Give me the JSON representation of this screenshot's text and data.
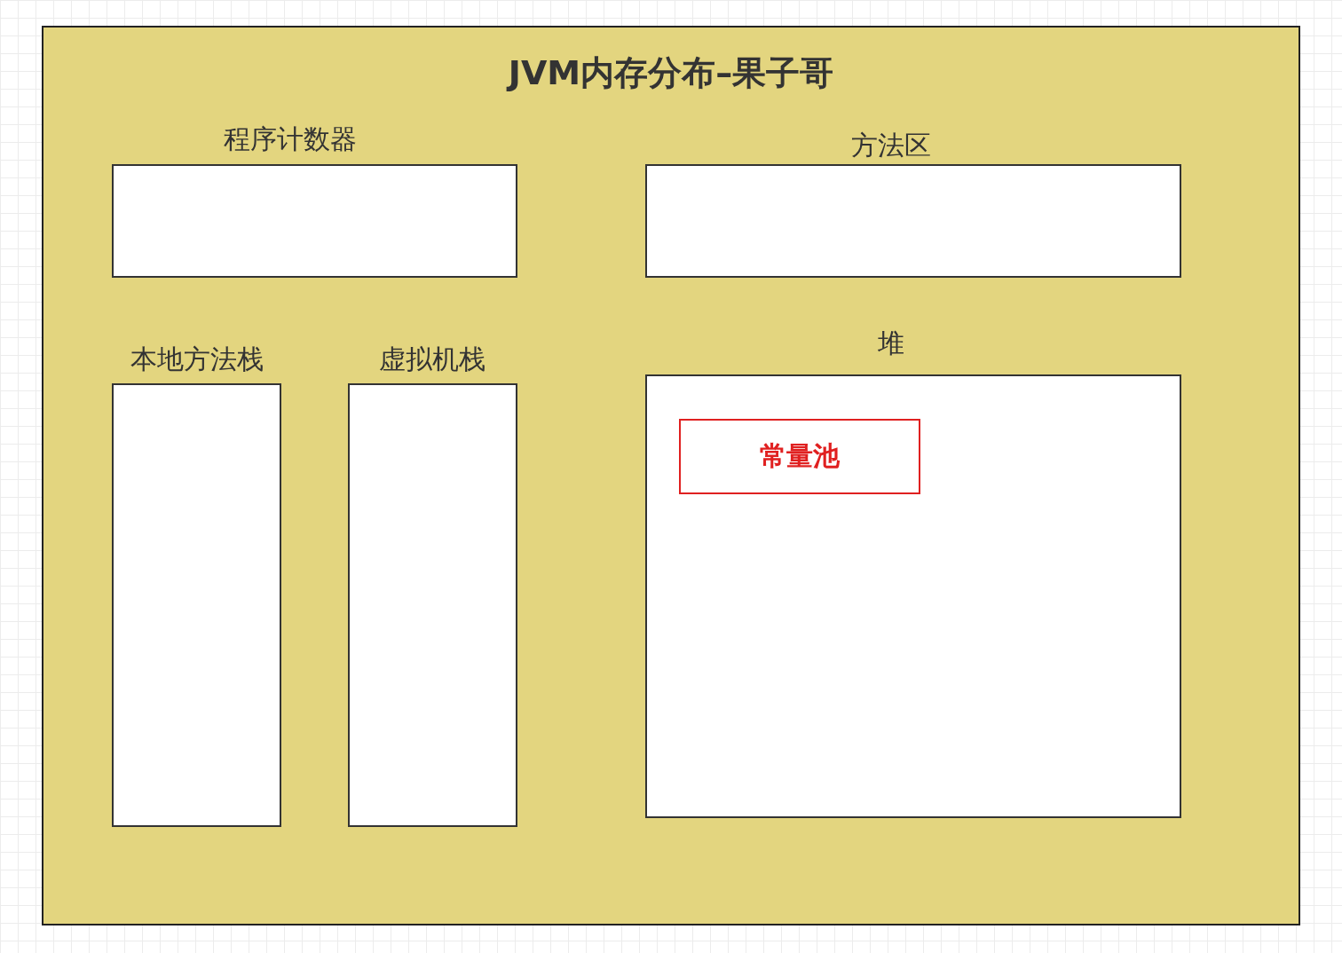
{
  "title": "JVM内存分布–果子哥",
  "regions": [
    {
      "label": "程序计数器"
    },
    {
      "label": "方法区"
    },
    {
      "label": "本地方法栈"
    },
    {
      "label": "虚拟机栈"
    },
    {
      "label": "堆",
      "children": [
        {
          "label": "常量池"
        }
      ]
    }
  ]
}
